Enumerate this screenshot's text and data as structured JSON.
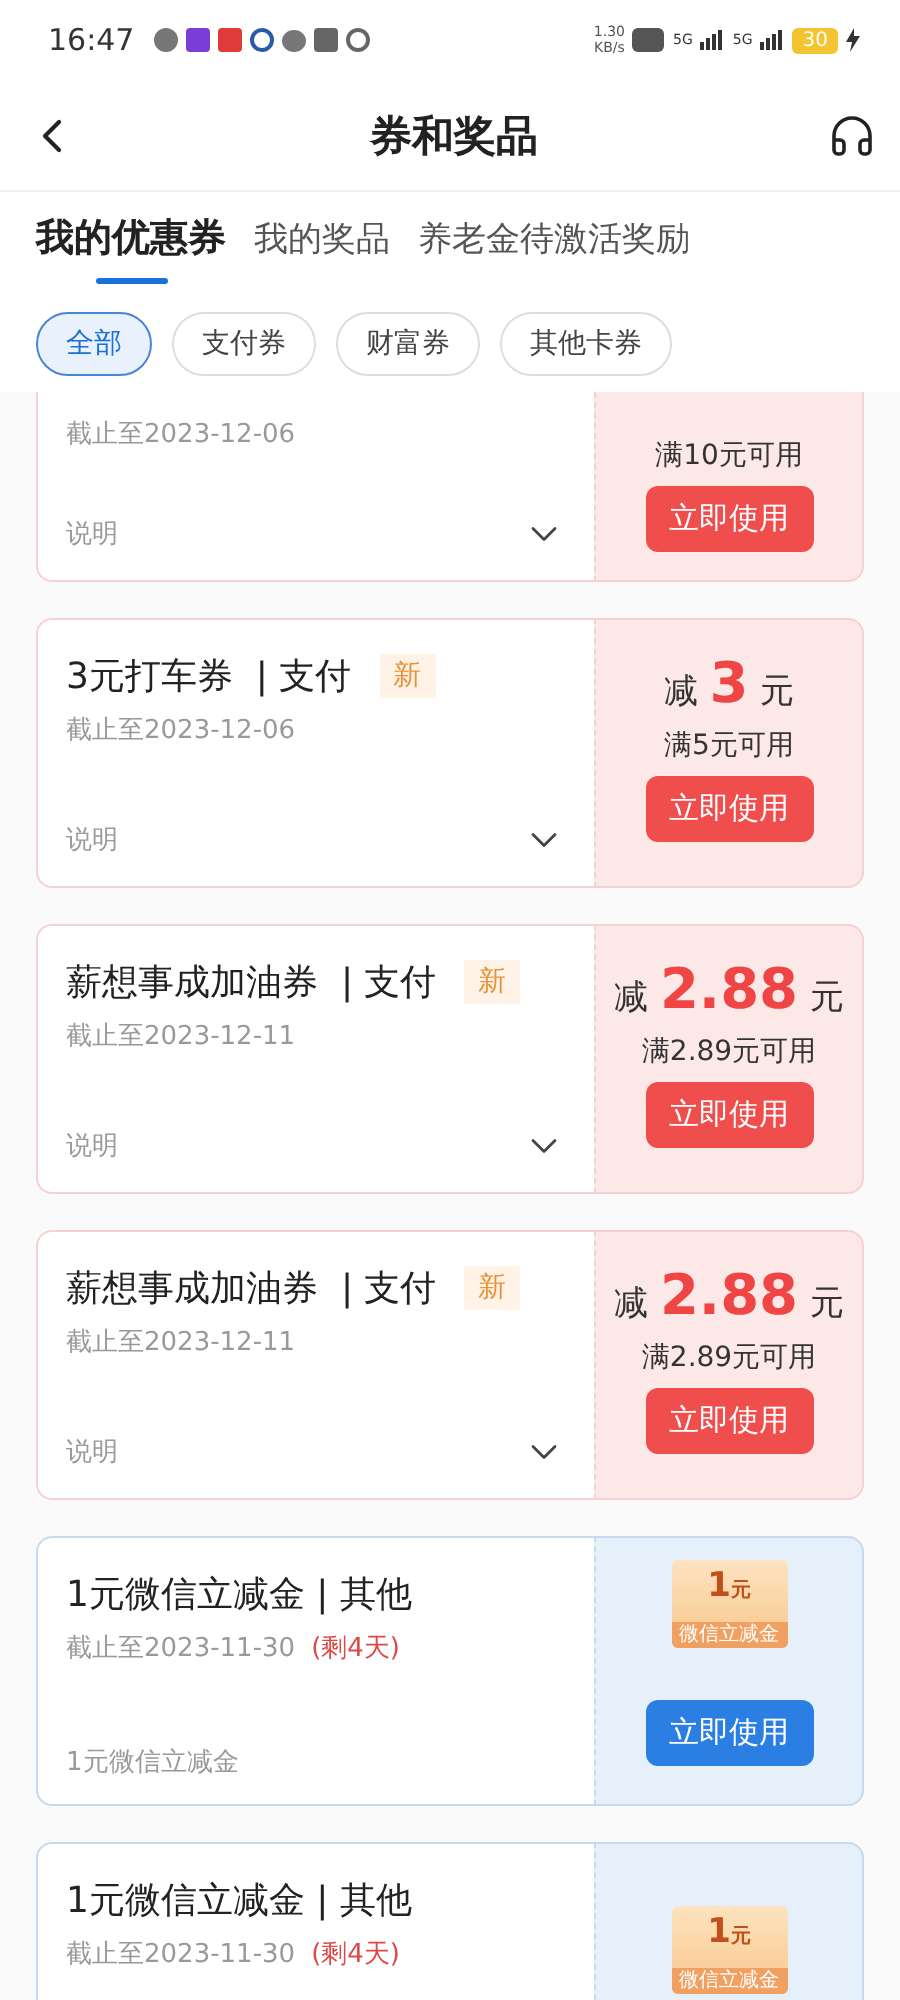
{
  "status_bar": {
    "time": "16:47",
    "speed": "1.30",
    "speed_unit": "KB/s",
    "network_1": "5G",
    "network_2": "5G",
    "battery": "30"
  },
  "header": {
    "title": "券和奖品"
  },
  "tabs": [
    {
      "label": "我的优惠券",
      "selected": true
    },
    {
      "label": "我的奖品",
      "selected": false
    },
    {
      "label": "养老金待激活奖励",
      "selected": false
    }
  ],
  "filters": [
    {
      "label": "全部",
      "selected": true
    },
    {
      "label": "支付券",
      "selected": false
    },
    {
      "label": "财富券",
      "selected": false
    },
    {
      "label": "其他卡券",
      "selected": false
    }
  ],
  "coupons": [
    {
      "kind": "discount",
      "partial": true,
      "date": "截止至2023-12-06",
      "description": "说明",
      "condition": "满10元可用",
      "button": "立即使用"
    },
    {
      "kind": "discount",
      "title": "3元打车券  | 支付",
      "badge": "新",
      "date": "截止至2023-12-06",
      "description": "说明",
      "prefix": "减",
      "amount": "3",
      "suffix": "元",
      "condition": "满5元可用",
      "button": "立即使用"
    },
    {
      "kind": "discount",
      "title": "薪想事成加油券  | 支付",
      "badge": "新",
      "date": "截止至2023-12-11",
      "description": "说明",
      "prefix": "减",
      "amount": "2.88",
      "suffix": "元",
      "condition": "满2.89元可用",
      "button": "立即使用"
    },
    {
      "kind": "discount",
      "title": "薪想事成加油券  | 支付",
      "badge": "新",
      "date": "截止至2023-12-11",
      "description": "说明",
      "prefix": "减",
      "amount": "2.88",
      "suffix": "元",
      "condition": "满2.89元可用",
      "button": "立即使用"
    },
    {
      "kind": "voucher",
      "title": "1元微信立减金 | 其他",
      "date": "截止至2023-11-30",
      "remaining": "(剩4天)",
      "description": "1元微信立减金",
      "voucher_value": "1",
      "voucher_unit": "元",
      "voucher_label": "微信立减金",
      "button": "立即使用"
    },
    {
      "kind": "voucher",
      "title": "1元微信立减金 | 其他",
      "date": "截止至2023-11-30",
      "remaining": "(剩4天)",
      "voucher_value": "1",
      "voucher_unit": "元",
      "voucher_label": "微信立减金"
    }
  ]
}
